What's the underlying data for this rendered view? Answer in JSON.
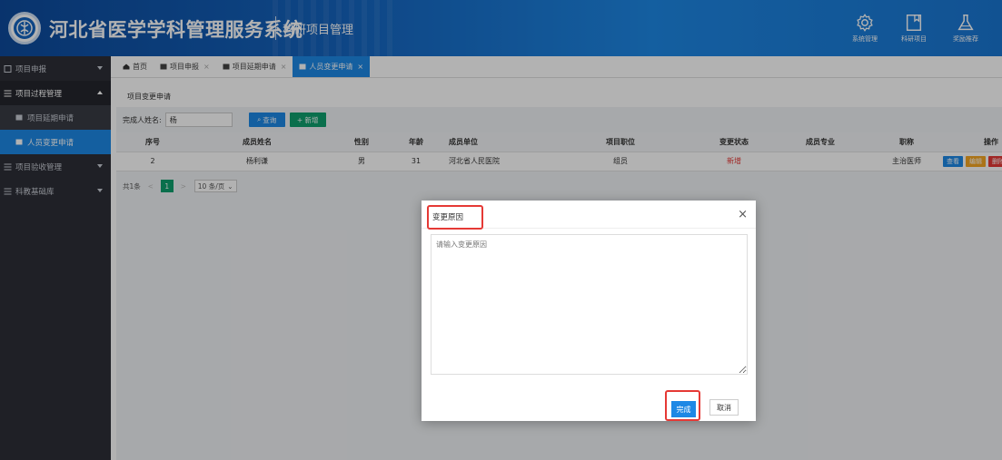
{
  "header": {
    "title": "河北省医学学科管理服务系统",
    "subtitle": "科研项目管理",
    "buttons": [
      {
        "label": "系统管理",
        "icon": "gear-icon"
      },
      {
        "label": "科研项目",
        "icon": "bookmark-icon"
      },
      {
        "label": "奖励推荐",
        "icon": "flask-icon"
      }
    ]
  },
  "sidebar": {
    "items": [
      {
        "label": "项目申报"
      },
      {
        "label": "项目过程管理"
      },
      {
        "label": "项目延期申请"
      },
      {
        "label": "人员变更申请"
      },
      {
        "label": "项目验收管理"
      },
      {
        "label": "科教基础库"
      }
    ]
  },
  "tabs": [
    {
      "label": "首页"
    },
    {
      "label": "项目申报"
    },
    {
      "label": "项目延期申请"
    },
    {
      "label": "人员变更申请"
    }
  ],
  "page": {
    "breadcrumb": "项目变更申请",
    "search_label": "完成人姓名:",
    "search_value": "杨",
    "query_label": "查询",
    "add_label": "+ 新增"
  },
  "table": {
    "headers": [
      "序号",
      "成员姓名",
      "性别",
      "年龄",
      "成员单位",
      "项目职位",
      "变更状态",
      "成员专业",
      "职称",
      "操作"
    ],
    "rows": [
      {
        "no": "2",
        "name": "杨利谦",
        "gender": "男",
        "age": "31",
        "unit": "河北省人民医院",
        "position": "组员",
        "status": "新增",
        "major": "",
        "title": "主治医师"
      }
    ],
    "op_buttons": [
      {
        "label": "查看",
        "color": "#1e88e5"
      },
      {
        "label": "编辑",
        "color": "#f5a623"
      },
      {
        "label": "删除",
        "color": "#e53935"
      }
    ]
  },
  "pager": {
    "total": "共1条",
    "prev": "<",
    "page": "1",
    "next": ">",
    "size": "10 条/页"
  },
  "dialog": {
    "title": "变更原因",
    "close": "×",
    "placeholder": "请输入变更原因",
    "ok": "完成",
    "cancel": "取消"
  },
  "colors": {
    "accent": "#1e88e5",
    "sidebar": "#2d2f37",
    "green": "#0f9f6e",
    "highlight": "#e53935"
  }
}
